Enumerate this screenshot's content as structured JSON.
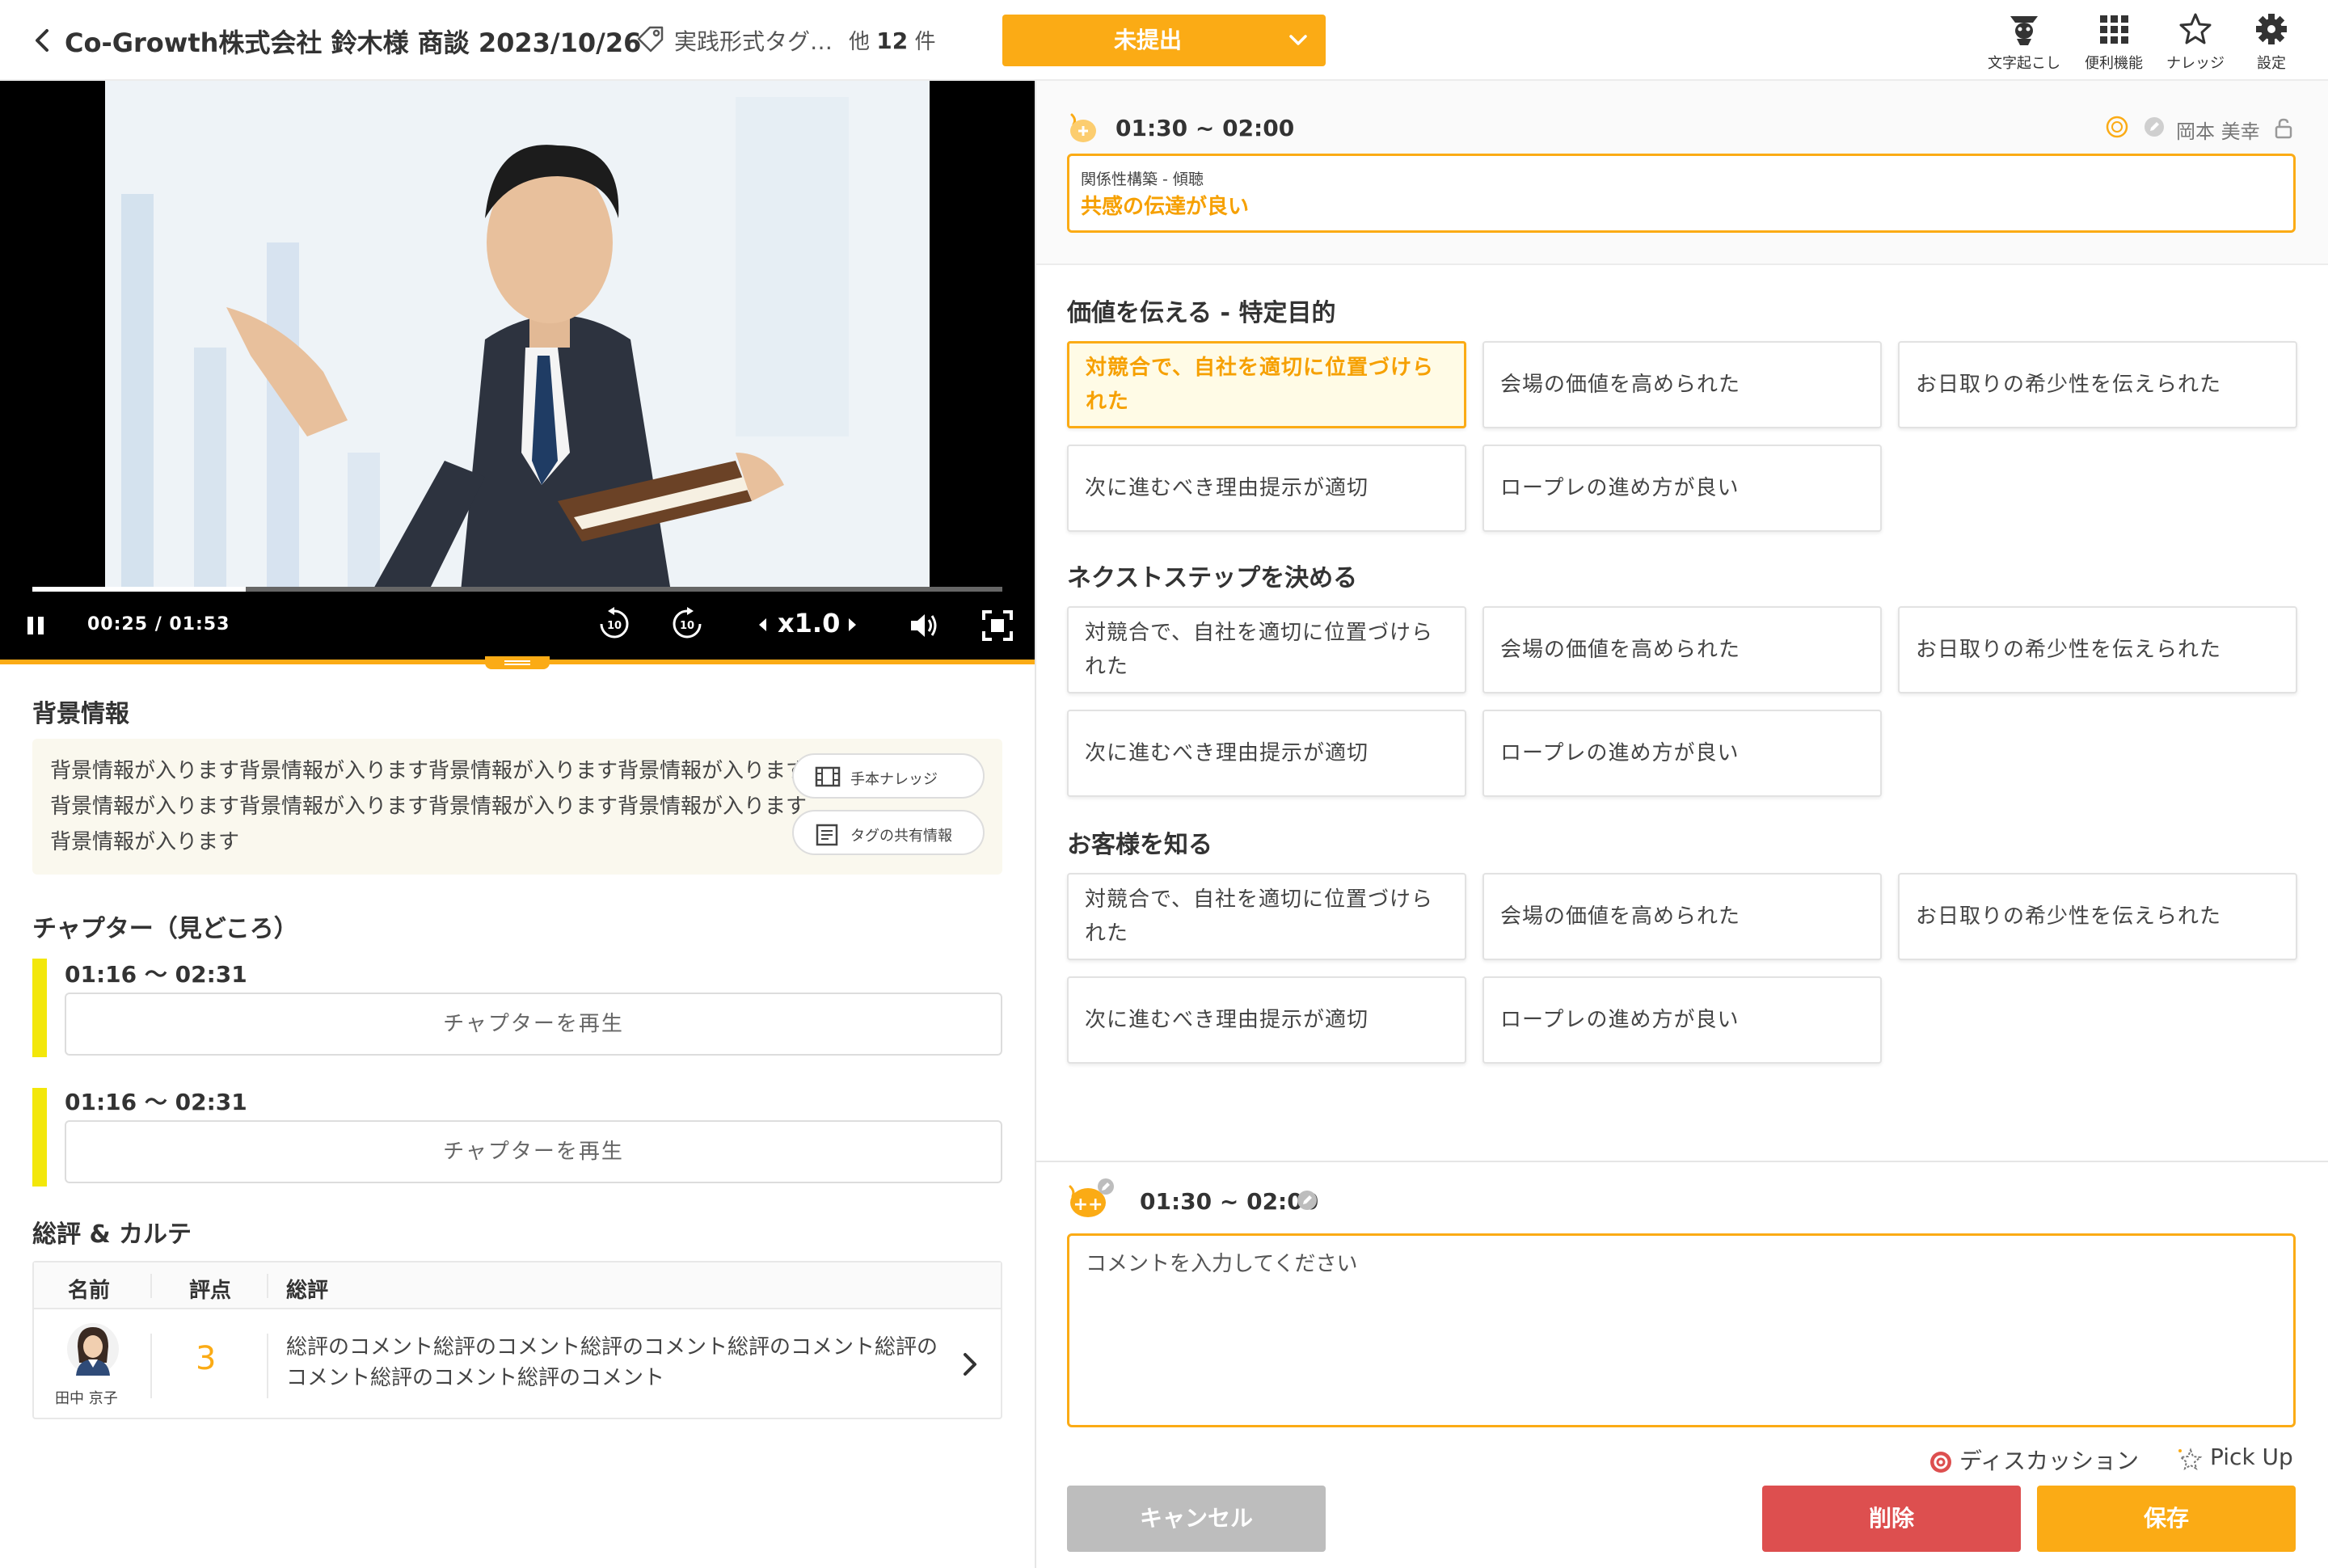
{
  "header": {
    "title": "Co-Growth株式会社 鈴木様 商談 2023/10/26",
    "tag_name": "実践形式タグ…",
    "more_prefix": "他",
    "more_count": "12",
    "more_suffix": "件",
    "status": "未提出",
    "tools": {
      "transcript": "文字起こし",
      "utilities": "便利機能",
      "knowledge": "ナレッジ",
      "settings": "設定"
    }
  },
  "player": {
    "time": "00:25 / 01:53",
    "speed": "x1.0",
    "progress": 0.22,
    "skip_seconds": "10"
  },
  "background": {
    "heading": "背景情報",
    "text": "背景情報が入ります背景情報が入ります背景情報が入ります背景情報が入ります背景情報が入ります背景情報が入ります背景情報が入ります背景情報が入ります背景情報が入ります",
    "model_knowledge": "手本ナレッジ",
    "tag_shared_info": "タグの共有情報"
  },
  "chapters": {
    "heading": "チャプター（見どころ）",
    "items": [
      {
        "time": "01:16 〜 02:31",
        "button": "チャプターを再生"
      },
      {
        "time": "01:16 〜 02:31",
        "button": "チャプターを再生"
      }
    ]
  },
  "review": {
    "heading": "総評 & カルテ",
    "columns": [
      "名前",
      "評点",
      "総評"
    ],
    "rows": [
      {
        "name": "田中 京子",
        "score": "3",
        "comment": "総評のコメント総評のコメント総評のコメント総評のコメント総評のコメント総評のコメント総評のコメント"
      }
    ]
  },
  "selected_segment": {
    "time": "01:30 ~ 02:00",
    "author": "岡本 美幸",
    "category": "関係性構築 - 傾聴",
    "value": "共感の伝達が良い"
  },
  "tag_groups": [
    {
      "heading": "価値を伝える - 特定目的",
      "tags": [
        "対競合で、自社を適切に位置づけられた",
        "会場の価値を高められた",
        "お日取りの希少性を伝えられた",
        "次に進むべき理由提示が適切",
        "ロープレの進め方が良い"
      ]
    },
    {
      "heading": "ネクストステップを決める",
      "tags": [
        "対競合で、自社を適切に位置づけられた",
        "会場の価値を高められた",
        "お日取りの希少性を伝えられた",
        "次に進むべき理由提示が適切",
        "ロープレの進め方が良い"
      ]
    },
    {
      "heading": "お客様を知る",
      "tags": [
        "対競合で、自社を適切に位置づけられた",
        "会場の価値を高められた",
        "お日取りの希少性を伝えられた",
        "次に進むべき理由提示が適切",
        "ロープレの進め方が良い"
      ]
    }
  ],
  "comment": {
    "time": "01:30 ~ 02:00",
    "placeholder": "コメントを入力してください",
    "discussion": "ディスカッション",
    "pickup": "Pick Up",
    "cancel": "キャンセル",
    "delete": "削除",
    "save": "保存"
  },
  "colors": {
    "accent": "#fbab15",
    "accent_text": "#f6a000",
    "delete": "#dd4f4f",
    "cancel": "#bdbdbd",
    "chapter_marker": "#f3e70a"
  }
}
